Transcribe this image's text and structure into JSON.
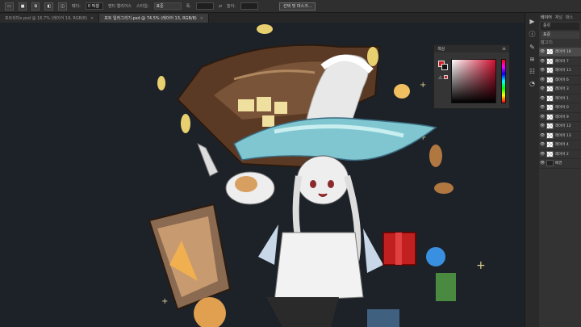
{
  "options_bar": {
    "feather_label": "페더:",
    "feather_value": "0 픽셀",
    "antialias_label": "앤티 앨리어스",
    "style_label": "스타일:",
    "style_value": "표준",
    "width_label": "폭:",
    "height_label": "높이:",
    "select_mask_label": "선택 및 마스크..."
  },
  "tabs": [
    {
      "label": "포트릿마x.psd @ 16.7% (레이어 19, RGB/8)",
      "active": false
    },
    {
      "label": "포트 일러그리기.psd @ 74.5% (레이어 13, RGB/8)",
      "active": true
    }
  ],
  "color_panel": {
    "title": "색상",
    "foreground_color": "#d0202c",
    "background_color": "#111111"
  },
  "layers_panel": {
    "tabs": [
      "레이어",
      "채널",
      "패스"
    ],
    "filter_label": "종류",
    "blend_mode": "표준",
    "lock_label": "잠그기:",
    "layers": [
      {
        "name": "레이어 18",
        "selected": true
      },
      {
        "name": "레이어 7",
        "selected": false
      },
      {
        "name": "레이어 11",
        "selected": false
      },
      {
        "name": "레이어 6",
        "selected": false
      },
      {
        "name": "레이어 3",
        "selected": false
      },
      {
        "name": "레이어 1",
        "selected": false
      },
      {
        "name": "레이어 0",
        "selected": false
      },
      {
        "name": "레이어 9",
        "selected": false
      },
      {
        "name": "레이어 12",
        "selected": false
      },
      {
        "name": "레이어 13",
        "selected": false
      },
      {
        "name": "레이어 4",
        "selected": false
      },
      {
        "name": "레이어 2",
        "selected": false
      },
      {
        "name": "배경",
        "selected": false,
        "background": true
      }
    ]
  }
}
